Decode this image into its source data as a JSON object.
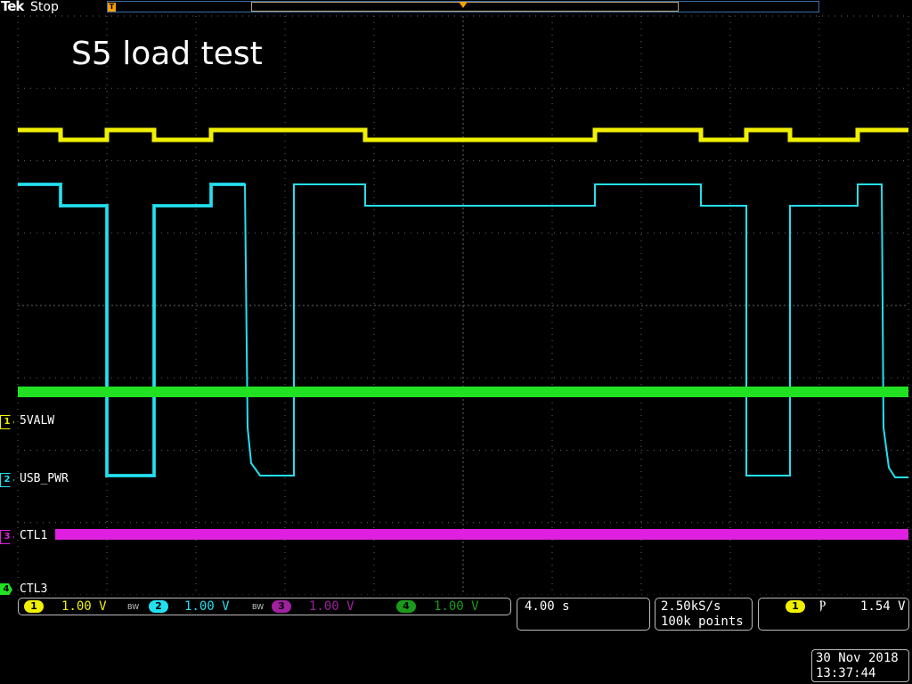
{
  "header": {
    "brand": "Tek",
    "status": "Stop",
    "trigger_position_marker": "T"
  },
  "title": "S5 load test",
  "channels": [
    {
      "num": "1",
      "name": "5VALW",
      "color": "#f0f000",
      "scale": "1.00 V"
    },
    {
      "num": "2",
      "name": "USB_PWR",
      "color": "#22e0f0",
      "scale": "1.00 V"
    },
    {
      "num": "3",
      "name": "CTL1",
      "color": "#e020e0",
      "scale": "1.00 V"
    },
    {
      "num": "4",
      "name": "CTL3",
      "color": "#22e022",
      "scale": "1.00 V"
    }
  ],
  "bandwidth_limit_label": "BW",
  "horizontal": {
    "time_per_div": "4.00 s"
  },
  "acquisition": {
    "sample_rate": "2.50kS/s",
    "record_length": "100k points"
  },
  "trigger": {
    "source": "1",
    "slope_icon": "falling-edge-icon",
    "slope_glyph": "Ⲣ",
    "level": "1.54 V"
  },
  "datetime": {
    "date": "30 Nov 2018",
    "time": "13:37:44"
  }
}
